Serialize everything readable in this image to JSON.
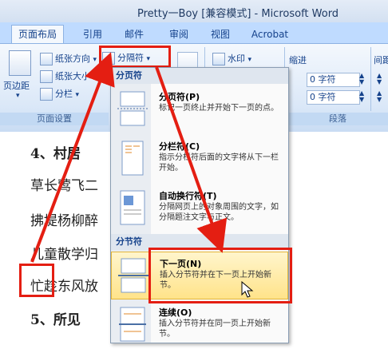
{
  "window": {
    "title": "Pretty一Boy [兼容模式] - Microsoft Word"
  },
  "tabs": [
    "页面布局",
    "引用",
    "邮件",
    "审阅",
    "视图",
    "Acrobat"
  ],
  "ribbon": {
    "paper_direction": "纸张方向",
    "paper_size": "纸张大小",
    "columns": "分栏",
    "margins": "页边距",
    "breaks": "分隔符",
    "watermark": "水印",
    "indent": "缩进",
    "spacing": "间距",
    "indent_value_1": "0 字符",
    "indent_value_2": "0 字符",
    "group_page_setup": "页面设置",
    "group_paragraph": "段落"
  },
  "document": {
    "lines": [
      "4、村居",
      "草长莺飞二",
      "拂堤杨柳醉",
      "儿童散学归",
      "忙趁东风放",
      "5、所见"
    ]
  },
  "menu": {
    "section1": "分页符",
    "section2": "分节符",
    "items": [
      {
        "title": "分页符(P)",
        "desc": "标记一页终止并开始下一页的点。"
      },
      {
        "title": "分栏符(C)",
        "desc": "指示分栏符后面的文字将从下一栏开始。"
      },
      {
        "title": "自动换行符(T)",
        "desc": "分隔网页上的对象周围的文字，如分隔题注文字与正文。"
      },
      {
        "title": "下一页(N)",
        "desc": "插入分节符并在下一页上开始新节。"
      },
      {
        "title": "连续(O)",
        "desc": "插入分节符并在同一页上开始新节。"
      }
    ]
  },
  "colors": {
    "accent_red": "#e41e12",
    "ribbon_blue": "#bfdbff",
    "hover_yellow": "#ffe38a"
  }
}
